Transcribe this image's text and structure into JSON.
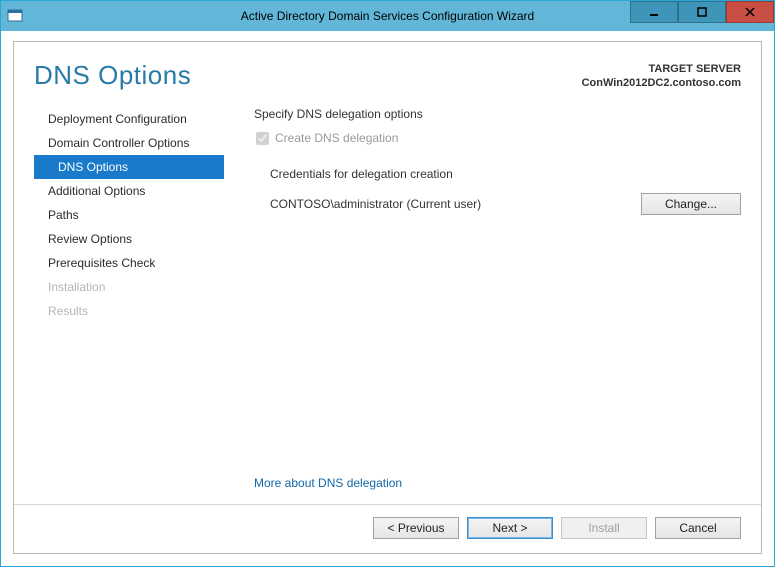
{
  "titlebar": {
    "title": "Active Directory Domain Services Configuration Wizard"
  },
  "header": {
    "page_title": "DNS Options",
    "target_server_label": "TARGET SERVER",
    "target_server_value": "ConWin2012DC2.contoso.com"
  },
  "sidebar": {
    "items": [
      {
        "label": "Deployment Configuration",
        "state": "normal"
      },
      {
        "label": "Domain Controller Options",
        "state": "normal"
      },
      {
        "label": "DNS Options",
        "state": "selected"
      },
      {
        "label": "Additional Options",
        "state": "normal"
      },
      {
        "label": "Paths",
        "state": "normal"
      },
      {
        "label": "Review Options",
        "state": "normal"
      },
      {
        "label": "Prerequisites Check",
        "state": "normal"
      },
      {
        "label": "Installation",
        "state": "disabled"
      },
      {
        "label": "Results",
        "state": "disabled"
      }
    ]
  },
  "main": {
    "section_label": "Specify DNS delegation options",
    "create_delegation_label": "Create DNS delegation",
    "create_delegation_checked": true,
    "create_delegation_enabled": false,
    "credentials_label": "Credentials for delegation creation",
    "credentials_value": "CONTOSO\\administrator (Current user)",
    "change_button": "Change...",
    "more_link": "More about DNS delegation"
  },
  "footer": {
    "previous": "< Previous",
    "next": "Next >",
    "install": "Install",
    "cancel": "Cancel"
  }
}
